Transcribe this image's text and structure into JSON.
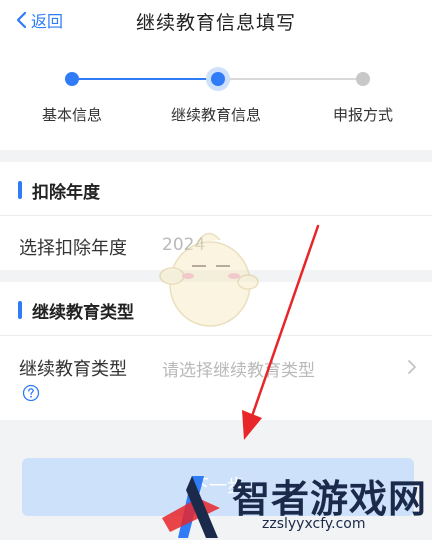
{
  "nav": {
    "back_label": "返回",
    "title": "继续教育信息填写"
  },
  "steps": [
    {
      "label": "基本信息",
      "state": "done"
    },
    {
      "label": "继续教育信息",
      "state": "current"
    },
    {
      "label": "申报方式",
      "state": "todo"
    }
  ],
  "year_section": {
    "title": "扣除年度",
    "field_label": "选择扣除年度",
    "field_value": "2024"
  },
  "type_section": {
    "title": "继续教育类型",
    "field_label": "继续教育类型",
    "field_placeholder": "请选择继续教育类型"
  },
  "next_button": {
    "label": "下一步"
  },
  "watermark": {
    "brand": "智者游戏网",
    "url": "zzslyyxcfy.com"
  },
  "colors": {
    "accent": "#2f7cf6",
    "background": "#f2f3f5",
    "button_disabled": "#cde1fb",
    "annotation_arrow": "#e8262a"
  }
}
